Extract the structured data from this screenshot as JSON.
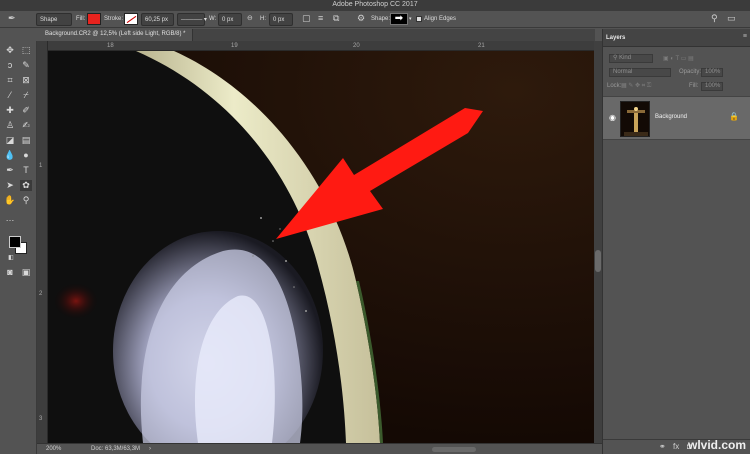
{
  "app_title": "Adobe Photoshop CC 2017",
  "options_bar": {
    "mode_value": "Shape",
    "fill_label": "Fill:",
    "fill_color": "#e8231e",
    "stroke_label": "Stroke:",
    "stroke_width_value": "60,25 px",
    "w_label": "W:",
    "w_value": "0 px",
    "h_label": "H:",
    "h_value": "0 px",
    "shape_label": "Shape:",
    "align_edges_label": "Align Edges"
  },
  "document": {
    "tab_label": "Background.CR2 @ 12,5% (Left side Light, RGB/8) *"
  },
  "rulers": {
    "top": [
      "18",
      "19",
      "20",
      "21"
    ],
    "left": [
      "1",
      "2",
      "3"
    ]
  },
  "status": {
    "zoom": "200%",
    "doc_size": "Doc: 63,3M/63,3M"
  },
  "layers_panel": {
    "tab_label": "Layers",
    "kind_value": "Kind",
    "blend_mode": "Normal",
    "opacity_label": "Opacity:",
    "opacity_value": "100%",
    "lock_label": "Lock:",
    "fill_label": "Fill:",
    "fill_value": "100%",
    "layer_name": "Background"
  },
  "watermark": "wlvid.com",
  "icons": {
    "fill_swatch_color": "#e8231e",
    "arrow_color": "#ff1a12"
  }
}
